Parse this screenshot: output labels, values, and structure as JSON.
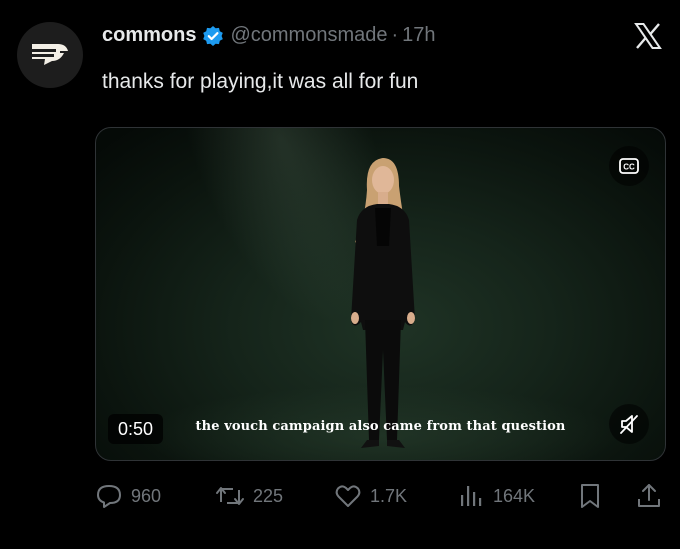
{
  "tweet": {
    "display_name": "commons",
    "handle": "@commonsmade",
    "separator": "·",
    "time": "17h",
    "text": "thanks for playing,it was all for fun",
    "verified": true
  },
  "media": {
    "duration": "0:50",
    "caption": "the vouch campaign also came from that question",
    "cc_icon": "closed-captions-icon",
    "mute_icon": "volume-muted-icon"
  },
  "actions": {
    "replies": "960",
    "reposts": "225",
    "likes": "1.7K",
    "views": "164K"
  },
  "colors": {
    "background": "#000000",
    "text": "#e7e9ea",
    "secondary": "#71767b",
    "verified_blue": "#1d9bf0"
  }
}
